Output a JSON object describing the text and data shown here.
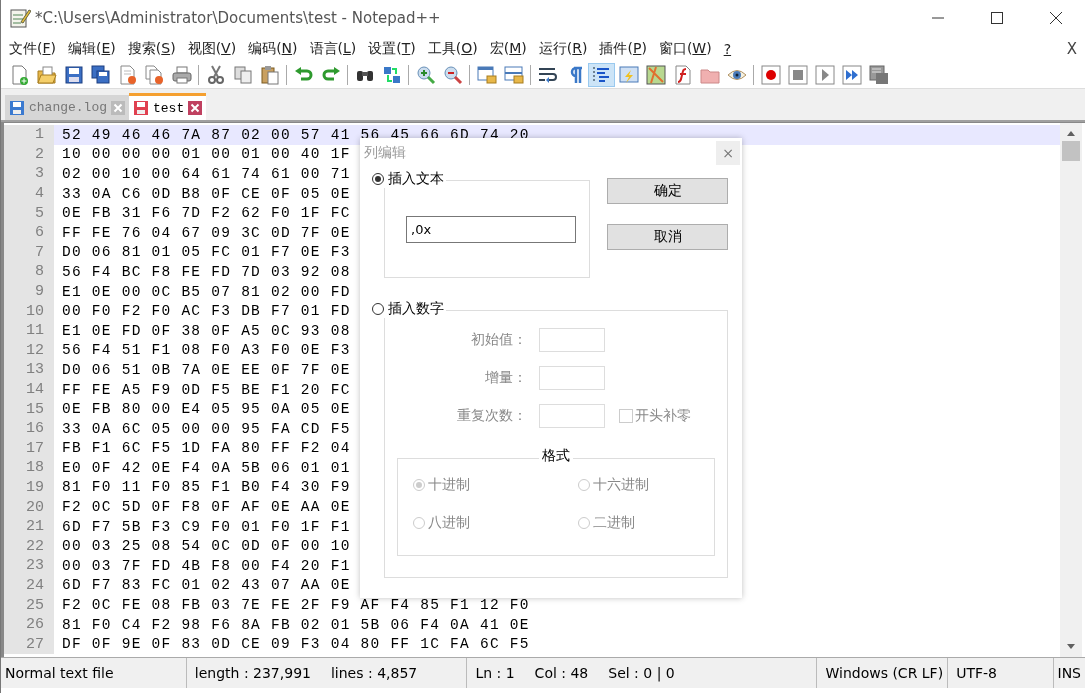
{
  "window": {
    "title": "*C:\\Users\\Administrator\\Documents\\test - Notepad++"
  },
  "menu": [
    {
      "pre": "文件(",
      "key": "F",
      "post": ")"
    },
    {
      "pre": "编辑(",
      "key": "E",
      "post": ")"
    },
    {
      "pre": "搜索(",
      "key": "S",
      "post": ")"
    },
    {
      "pre": "视图(",
      "key": "V",
      "post": ")"
    },
    {
      "pre": "编码(",
      "key": "N",
      "post": ")"
    },
    {
      "pre": "语言(",
      "key": "L",
      "post": ")"
    },
    {
      "pre": "设置(",
      "key": "T",
      "post": ")"
    },
    {
      "pre": "工具(",
      "key": "O",
      "post": ")"
    },
    {
      "pre": "宏(",
      "key": "M",
      "post": ")"
    },
    {
      "pre": "运行(",
      "key": "R",
      "post": ")"
    },
    {
      "pre": "插件(",
      "key": "P",
      "post": ")"
    },
    {
      "pre": "窗口(",
      "key": "W",
      "post": ")"
    },
    {
      "key": "?"
    }
  ],
  "menu_close": "X",
  "toolbar": [
    {
      "kind": "new",
      "pressed": false
    },
    {
      "kind": "open",
      "pressed": false
    },
    {
      "kind": "save",
      "pressed": false
    },
    {
      "kind": "saveall",
      "pressed": false
    },
    {
      "kind": "close",
      "pressed": false
    },
    {
      "kind": "closeall",
      "pressed": false
    },
    {
      "kind": "print",
      "pressed": false
    },
    {
      "kind": "sep"
    },
    {
      "kind": "cut",
      "pressed": false
    },
    {
      "kind": "copy",
      "pressed": false
    },
    {
      "kind": "paste",
      "pressed": false
    },
    {
      "kind": "sep"
    },
    {
      "kind": "undo",
      "pressed": false
    },
    {
      "kind": "redo",
      "pressed": false
    },
    {
      "kind": "sep"
    },
    {
      "kind": "find",
      "pressed": false
    },
    {
      "kind": "replace",
      "pressed": false
    },
    {
      "kind": "sep"
    },
    {
      "kind": "zoomin",
      "pressed": false
    },
    {
      "kind": "zoomout",
      "pressed": false
    },
    {
      "kind": "sep"
    },
    {
      "kind": "syncv",
      "pressed": false
    },
    {
      "kind": "synch",
      "pressed": false
    },
    {
      "kind": "sep"
    },
    {
      "kind": "wrap",
      "pressed": false
    },
    {
      "kind": "pilcrow",
      "pressed": false
    },
    {
      "kind": "indent",
      "pressed": true
    },
    {
      "kind": "lang",
      "pressed": false
    },
    {
      "kind": "map",
      "pressed": false
    },
    {
      "kind": "func",
      "pressed": false
    },
    {
      "kind": "folder",
      "pressed": false
    },
    {
      "kind": "eye",
      "pressed": false
    },
    {
      "kind": "sep"
    },
    {
      "kind": "record",
      "pressed": false
    },
    {
      "kind": "stop",
      "pressed": false
    },
    {
      "kind": "play",
      "pressed": false
    },
    {
      "kind": "playmulti",
      "pressed": false
    },
    {
      "kind": "savemacro",
      "pressed": false
    }
  ],
  "tabs": [
    {
      "label": "change.log",
      "selected": false
    },
    {
      "label": "test",
      "selected": true
    }
  ],
  "editor": {
    "lines": [
      {
        "number": "1",
        "text": "52 49 46 46 7A 87 02 00 57 41 56 45 66 6D 74 20",
        "current": true
      },
      {
        "number": "2",
        "text": "10 00 00 00 01 00 01 00 40 1F",
        "current": false
      },
      {
        "number": "3",
        "text": "02 00 10 00 64 61 74 61 00 71",
        "current": false
      },
      {
        "number": "4",
        "text": "33 0A C6 0D B8 0F CE 0F 05 0E",
        "current": false
      },
      {
        "number": "5",
        "text": "0E FB 31 F6 7D F2 62 F0 1F FC",
        "current": false
      },
      {
        "number": "6",
        "text": "FF FE 76 04 67 09 3C 0D 7F 0E",
        "current": false
      },
      {
        "number": "7",
        "text": "D0 06 81 01 05 FC 01 F7 0E F3",
        "current": false
      },
      {
        "number": "8",
        "text": "56 F4 BC F8 FE FD 7D 03 92 08",
        "current": false
      },
      {
        "number": "9",
        "text": "E1 0E 00 0C B5 07 81 02 00 FD",
        "current": false
      },
      {
        "number": "10",
        "text": "00 F0 F2 F0 AC F3 DB F7 01 FD",
        "current": false
      },
      {
        "number": "11",
        "text": "E1 0E FD 0F 38 0F A5 0C 93 08",
        "current": false
      },
      {
        "number": "12",
        "text": "56 F4 51 F1 08 F0 A3 F0 0E F3",
        "current": false
      },
      {
        "number": "13",
        "text": "D0 06 51 0B 7A 0E EE 0F 7F 0E",
        "current": false
      },
      {
        "number": "14",
        "text": "FF FE A5 F9 0D F5 BE F1 20 FC",
        "current": false
      },
      {
        "number": "15",
        "text": "0E FB 80 00 E4 05 95 0A 05 0E",
        "current": false
      },
      {
        "number": "16",
        "text": "33 0A 6C 05 00 00 95 FA CD F5",
        "current": false
      },
      {
        "number": "17",
        "text": "FB F1 6C F5 1D FA 80 FF F2 04",
        "current": false
      },
      {
        "number": "18",
        "text": "E0 0F 42 0E F4 0A 5B 06 01 01",
        "current": false
      },
      {
        "number": "19",
        "text": "81 F0 11 F0 85 F1 B0 F4 30 F9",
        "current": false
      },
      {
        "number": "20",
        "text": "F2 0C 5D 0F F8 0F AF 0E AA 0E",
        "current": false
      },
      {
        "number": "21",
        "text": "6D F7 5B F3 C9 F0 01 F0 1F F1",
        "current": false
      },
      {
        "number": "22",
        "text": "00 03 25 08 54 0C 0D 0F 00 10",
        "current": false
      },
      {
        "number": "23",
        "text": "00 03 7F FD 4B F8 00 F4 20 F1",
        "current": false
      },
      {
        "number": "24",
        "text": "6D F7 83 FC 01 02 43 07 AA 0E",
        "current": false
      },
      {
        "number": "25",
        "text": "F2 0C FE 08 FB 03 7E FE 2F F9 AF F4 85 F1 12 F0",
        "current": false
      },
      {
        "number": "26",
        "text": "81 F0 C4 F2 98 F6 8A FB 02 01 5B 06 F4 0A 41 0E",
        "current": false
      },
      {
        "number": "27",
        "text": "DF 0F 9E 0F 83 0D CE 09 F3 04 80 FF 1C FA 6C F5",
        "current": false
      }
    ]
  },
  "dialog": {
    "title": "列编辑",
    "close": "×",
    "text_group": {
      "label": "插入文本",
      "selected": true,
      "value": ",0x"
    },
    "buttons": [
      "确定",
      "取消"
    ],
    "number_group": {
      "label": "插入数字",
      "selected": false,
      "fields": [
        {
          "label": "初始值："
        },
        {
          "label": "增量："
        },
        {
          "label": "重复次数："
        }
      ],
      "leading_zeros": {
        "label": "开头补零",
        "checked": false
      },
      "format": {
        "title": "格式",
        "options": [
          {
            "label": "十进制",
            "selected": true
          },
          {
            "label": "十六进制",
            "selected": false
          },
          {
            "label": "八进制",
            "selected": false
          },
          {
            "label": "二进制",
            "selected": false
          }
        ]
      }
    }
  },
  "status_bar": [
    [
      "Normal text file"
    ],
    [
      "length : 237,991",
      "lines : 4,857"
    ],
    [
      "Ln : 1",
      "Col : 48",
      "Sel : 0 | 0"
    ],
    [
      "Windows (CR LF)"
    ],
    [
      "UTF-8"
    ],
    [
      "INS"
    ]
  ]
}
